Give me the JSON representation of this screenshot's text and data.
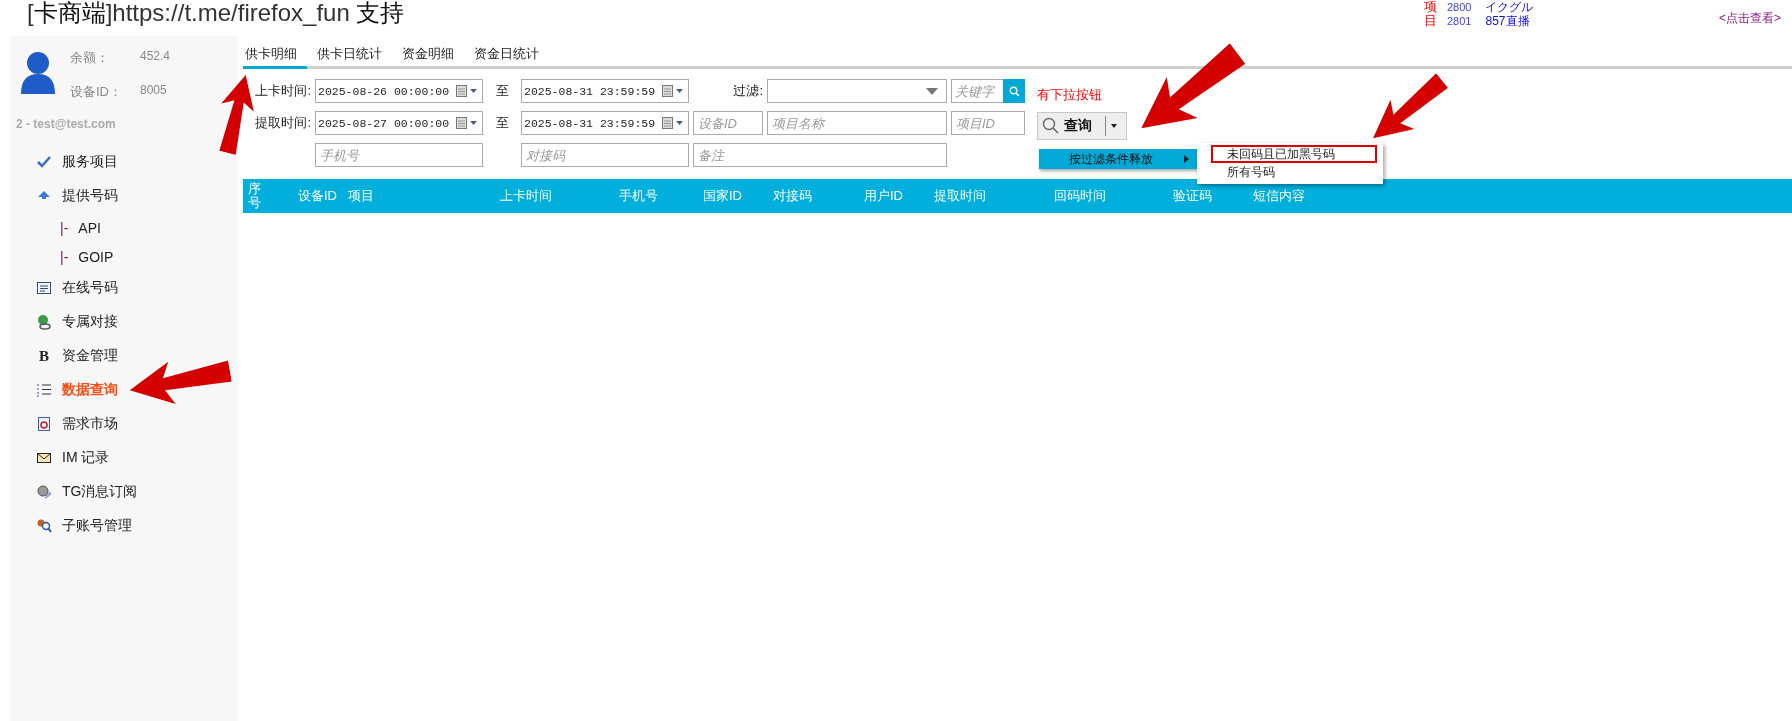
{
  "header": {
    "title": "[**卡商端**]https://t.me/firefox_fun **支持**",
    "projects_label": "项目",
    "projects": [
      {
        "id": "2800",
        "name": "イクグル"
      },
      {
        "id": "2801",
        "name": "857直播"
      }
    ],
    "view_link": "<点击查看>"
  },
  "account": {
    "balance_label": "余额：",
    "balance": "452.4",
    "device_label": "设备ID：",
    "device_id": "8005",
    "user": "2 - test@test.com"
  },
  "sidebar": {
    "items": [
      {
        "label": "服务项目",
        "selected": false
      },
      {
        "label": "提供号码",
        "selected": false,
        "children": [
          {
            "prefix": "|-",
            "label": "API",
            "selected": false
          },
          {
            "prefix": "|-",
            "label": "GOIP",
            "selected": false
          }
        ]
      },
      {
        "label": "在线号码",
        "selected": false
      },
      {
        "label": "专属对接",
        "selected": false
      },
      {
        "label": "资金管理",
        "selected": false,
        "glyph": "B"
      },
      {
        "label": "数据查询",
        "selected": true
      },
      {
        "label": "需求市场",
        "selected": false
      },
      {
        "label": "IM 记录",
        "selected": false
      },
      {
        "label": "TG消息订阅",
        "selected": false
      },
      {
        "label": "子账号管理",
        "selected": false
      }
    ]
  },
  "tabs": [
    {
      "label": "供卡明细",
      "selected": true
    },
    {
      "label": "供卡日统计",
      "selected": false
    },
    {
      "label": "资金明细",
      "selected": false
    },
    {
      "label": "资金日统计",
      "selected": false
    }
  ],
  "time_filters": [
    {
      "label": "上卡时间:",
      "from": "2025-08-26 00:00:00",
      "to_label": "至",
      "to": "2025-08-31 23:59:59"
    },
    {
      "label": "提取时间:",
      "from": "2025-08-27 00:00:00",
      "to_label": "至",
      "to": "2025-08-31 23:59:59"
    }
  ],
  "filter": {
    "label": "过滤:"
  },
  "keyword": {
    "placeholder": "关键字"
  },
  "fields": [
    {
      "placeholder": "设备ID"
    },
    {
      "placeholder": "项目名称"
    },
    {
      "placeholder": "项目ID"
    },
    {
      "placeholder": "手机号"
    },
    {
      "placeholder": "对接码"
    },
    {
      "placeholder": "备注"
    }
  ],
  "annotation": "有下拉按钮",
  "query_button": {
    "label": "查询"
  },
  "menu": {
    "items": [
      {
        "label": "按过滤条件释放",
        "selected": true
      }
    ]
  },
  "submenu": {
    "items": [
      {
        "label": "未回码且已加黑号码",
        "annotated": true
      },
      {
        "label": "所有号码",
        "annotated": false
      }
    ]
  },
  "table": {
    "columns": [
      "序号",
      "设备ID",
      "项目",
      "上卡时间",
      "手机号",
      "国家ID",
      "对接码",
      "用户ID",
      "提取时间",
      "回码时间",
      "验证码",
      "短信内容"
    ]
  }
}
